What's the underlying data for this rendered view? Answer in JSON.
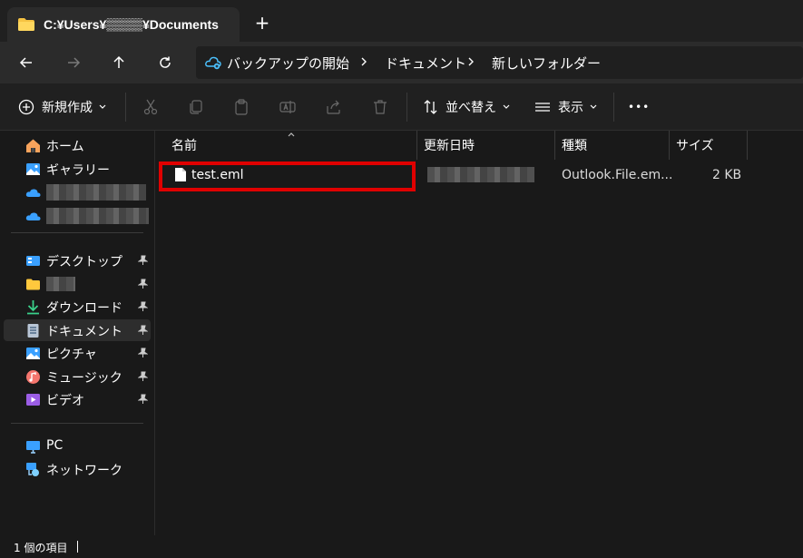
{
  "tab": {
    "title": "C:¥Users¥▒▒▒▒¥Documents",
    "new_tab": "+"
  },
  "address": {
    "crumbs": [
      "バックアップの開始",
      "ドキュメント",
      "新しいフォルダー"
    ]
  },
  "toolbar": {
    "new_label": "新規作成",
    "sort_label": "並べ替え",
    "view_label": "表示",
    "more_label": "•••"
  },
  "sidebar": {
    "items": [
      {
        "label": "ホーム",
        "icon": "home-icon"
      },
      {
        "label": "ギャラリー",
        "icon": "gallery-icon"
      },
      {
        "label": "",
        "icon": "onedrive-icon"
      },
      {
        "label": "",
        "icon": "onedrive-icon"
      },
      {
        "label": "デスクトップ",
        "icon": "desktop-icon"
      },
      {
        "label": "",
        "icon": "folder-icon"
      },
      {
        "label": "ダウンロード",
        "icon": "download-icon"
      },
      {
        "label": "ドキュメント",
        "icon": "documents-icon"
      },
      {
        "label": "ピクチャ",
        "icon": "pictures-icon"
      },
      {
        "label": "ミュージック",
        "icon": "music-icon"
      },
      {
        "label": "ビデオ",
        "icon": "video-icon"
      },
      {
        "label": "PC",
        "icon": "pc-icon"
      },
      {
        "label": "ネットワーク",
        "icon": "network-icon"
      }
    ]
  },
  "columns": {
    "name": "名前",
    "date": "更新日時",
    "type": "種類",
    "size": "サイズ"
  },
  "files": [
    {
      "name": "test.eml",
      "date": "",
      "type": "Outlook.File.em...",
      "size": "2 KB"
    }
  ],
  "status": {
    "count": "1 個の項目"
  },
  "colors": {
    "highlight": "#e00000",
    "selected_bg": "#2d2d2d",
    "accent": "#4cc2ff"
  }
}
